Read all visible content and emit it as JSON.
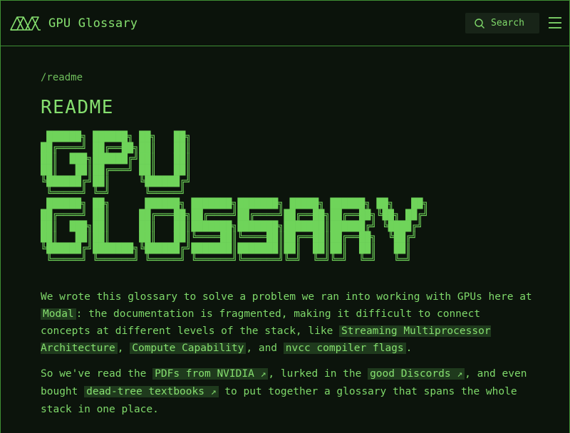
{
  "header": {
    "logo_text": "GPU Glossary",
    "search_label": "Search"
  },
  "page": {
    "breadcrumb": "/readme",
    "title": "README",
    "ascii_art": [
      " ██████╗ ██████╗ ██╗   ██╗",
      "██╔════╝ ██╔══██╗██║   ██║",
      "██║  ███╗██████╔╝██║   ██║",
      "██║   ██║██╔═══╝ ██║   ██║",
      "╚██████╔╝██║     ╚██████╔╝",
      " ╚═════╝ ╚═╝      ╚═════╝",
      " ██████╗ ██╗      ██████╗ ███████╗███████╗ █████╗ ██████╗ ██╗   ██╗",
      "██╔════╝ ██║     ██╔═══██╗██╔════╝██╔════╝██╔══██╗██╔══██╗╚██╗ ██╔╝",
      "██║  ███╗██║     ██║   ██║███████╗███████╗███████║██████╔╝ ╚████╔╝",
      "██║   ██║██║     ██║   ██║╚════██║╚════██║██╔══██║██╔══██╗  ╚██╔╝",
      "╚██████╔╝███████╗╚██████╔╝███████║███████║██║  ██║██║  ██║   ██║",
      " ╚═════╝ ╚══════╝ ╚═════╝ ╚══════╝╚══════╝╚═╝  ╚═╝╚═╝  ╚═╝   ╚═╝"
    ]
  },
  "intro": {
    "p1_a": "We wrote this glossary to solve a problem we ran into working with GPUs here at ",
    "link_modal": "Modal",
    "p1_b": ": the documentation is fragmented, making it difficult to connect concepts at different levels of the stack, like ",
    "link_sm": "Streaming Multiprocessor Architecture",
    "p1_c": ", ",
    "link_cc": "Compute Capability",
    "p1_d": ", and ",
    "link_nvcc": "nvcc compiler flags",
    "p1_e": ".",
    "p2_a": "So we've read the ",
    "link_pdfs": "PDFs from NVIDIA",
    "p2_b": ", lurked in the ",
    "link_discords": "good Discords",
    "p2_c": ", and even bought ",
    "link_textbooks": "dead-tree textbooks",
    "p2_d": " to put together a glossary that spans the whole stack in one place.",
    "external_arrow": "↗"
  },
  "icons": {
    "logo": "modal-logo-icon",
    "search": "search-icon",
    "menu": "hamburger-menu-icon",
    "external": "external-link-arrow-icon"
  },
  "colors": {
    "background": "#0c140c",
    "accent": "#7fd96a",
    "border": "#3f8f34",
    "link_bg": "#1f3a1d"
  }
}
